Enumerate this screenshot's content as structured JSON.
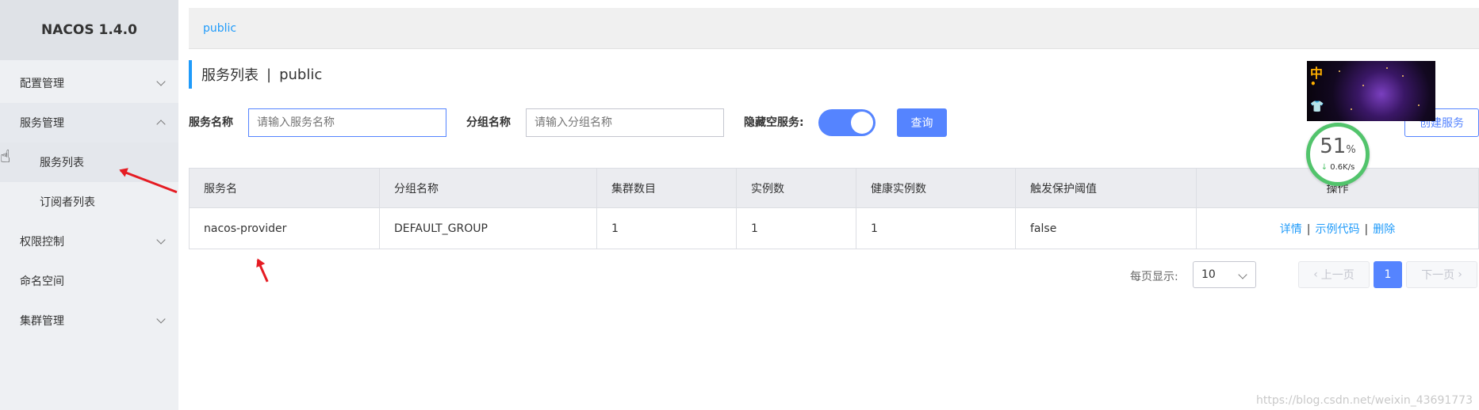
{
  "sidebar": {
    "title": "NACOS 1.4.0",
    "items": [
      {
        "label": "配置管理"
      },
      {
        "label": "服务管理"
      },
      {
        "label": "服务列表"
      },
      {
        "label": "订阅者列表"
      },
      {
        "label": "权限控制"
      },
      {
        "label": "命名空间"
      },
      {
        "label": "集群管理"
      }
    ]
  },
  "breadcrumb": {
    "namespace": "public"
  },
  "page": {
    "title": "服务列表",
    "separator": "|",
    "namespace": "public"
  },
  "form": {
    "service_name_label": "服务名称",
    "service_name_placeholder": "请输入服务名称",
    "group_name_label": "分组名称",
    "group_name_placeholder": "请输入分组名称",
    "hide_empty_label": "隐藏空服务:",
    "hide_empty_on": true,
    "query_button": "查询",
    "create_button": "创建服务"
  },
  "table": {
    "columns": [
      "服务名",
      "分组名称",
      "集群数目",
      "实例数",
      "健康实例数",
      "触发保护阈值",
      "操作"
    ],
    "rows": [
      {
        "service": "nacos-provider",
        "group": "DEFAULT_GROUP",
        "clusters": "1",
        "instances": "1",
        "healthy": "1",
        "protect": "false",
        "actions": [
          "详情",
          "示例代码",
          "删除"
        ]
      }
    ]
  },
  "pagination": {
    "per_page_label": "每页显示:",
    "page_size": "10",
    "prev": "上一页",
    "current": "1",
    "next": "下一页"
  },
  "overlay": {
    "thumb_chars": [
      "中",
      "•",
      "👕"
    ],
    "speed_percent": "51",
    "speed_percent_unit": "%",
    "speed_rate": "0.6K/s",
    "speed_arrow": "↓"
  },
  "watermark": "https://blog.csdn.net/weixin_43691773",
  "colors": {
    "accent": "#5584ff",
    "link": "#209bfa",
    "annotation": "#e51c23",
    "speed_ring": "#52c46c"
  }
}
